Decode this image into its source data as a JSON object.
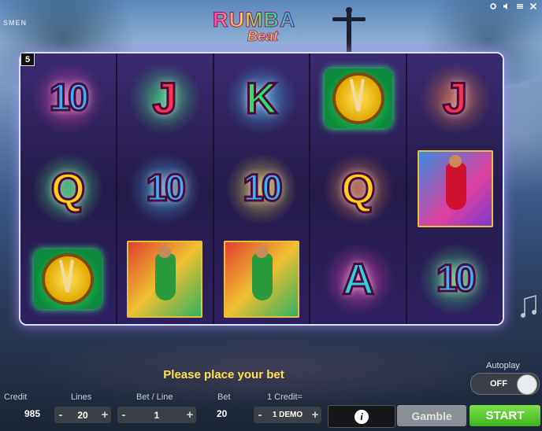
{
  "game": {
    "logo_line1": "RUMBA",
    "logo_line2": "Beat",
    "corner_label": "SMEN",
    "active_lines_badge": "5"
  },
  "window_icons": [
    "gear-icon",
    "speaker-icon",
    "settings-icon",
    "close-icon"
  ],
  "reels": [
    [
      {
        "type": "number",
        "text": "10",
        "color": "#3ab0ff"
      },
      {
        "type": "letter",
        "text": "Q",
        "color": "#ffcf1a"
      },
      {
        "type": "drum"
      }
    ],
    [
      {
        "type": "letter",
        "text": "J",
        "color": "#ff3050"
      },
      {
        "type": "number",
        "text": "10",
        "color": "#3ab0ff"
      },
      {
        "type": "dancer",
        "palette": "green"
      }
    ],
    [
      {
        "type": "letter",
        "text": "K",
        "color": "#30e060"
      },
      {
        "type": "number",
        "text": "10",
        "color": "#3ab0ff"
      },
      {
        "type": "dancer",
        "palette": "green"
      }
    ],
    [
      {
        "type": "drum"
      },
      {
        "type": "letter",
        "text": "Q",
        "color": "#ffcf1a"
      },
      {
        "type": "letter",
        "text": "A",
        "color": "#30d0e0"
      }
    ],
    [
      {
        "type": "letter",
        "text": "J",
        "color": "#ff3050"
      },
      {
        "type": "dancer",
        "palette": "red"
      },
      {
        "type": "number",
        "text": "10",
        "color": "#3ab0ff"
      }
    ]
  ],
  "status": {
    "prompt": "Please place your bet"
  },
  "controls": {
    "credit_label": "Credit",
    "credit_value": "985",
    "lines_label": "Lines",
    "lines_value": "20",
    "bet_line_label": "Bet / Line",
    "bet_line_value": "1",
    "bet_label": "Bet",
    "bet_value": "20",
    "denom_label": "1 Credit=",
    "denom_value": "1 DEMO",
    "minus": "-",
    "plus": "+",
    "autoplay_label": "Autoplay",
    "autoplay_state": "OFF",
    "info_label": "i",
    "gamble_label": "Gamble",
    "start_label": "START"
  },
  "colors": {
    "prompt": "#ffe24a",
    "start": "#4fc22a",
    "gamble": "#8b9096",
    "frame_glow": "#d9e3ff"
  }
}
